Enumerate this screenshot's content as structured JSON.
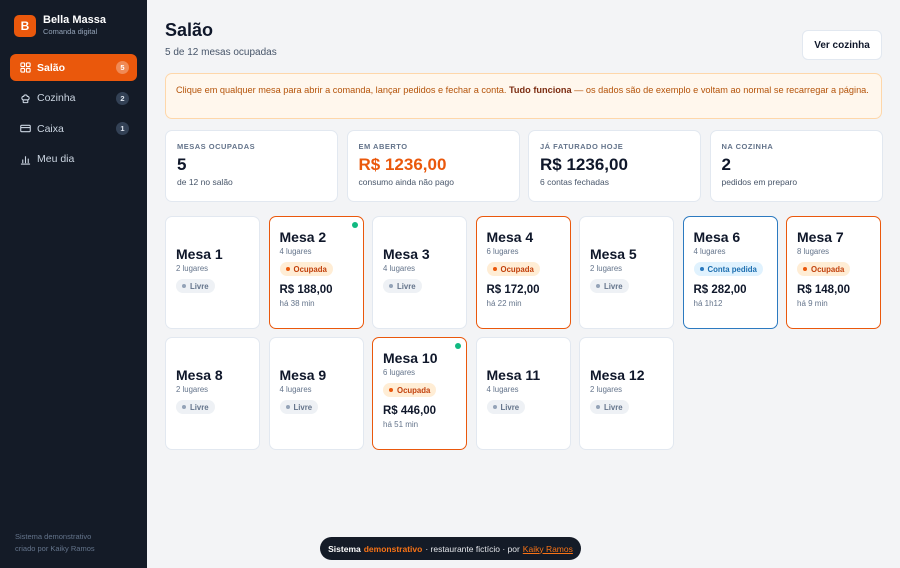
{
  "brand": {
    "logo_letter": "B",
    "name": "Bella Massa",
    "subtitle": "Comanda digital"
  },
  "sidebar": {
    "items": [
      {
        "label": "Salão",
        "badge": "5",
        "icon": "grid-icon",
        "active": true
      },
      {
        "label": "Cozinha",
        "badge": "2",
        "icon": "chef-hat-icon",
        "active": false
      },
      {
        "label": "Caixa",
        "badge": "1",
        "icon": "credit-card-icon",
        "active": false
      },
      {
        "label": "Meu dia",
        "badge": "",
        "icon": "bar-chart-icon",
        "active": false
      }
    ],
    "footer_line1": "Sistema demonstrativo",
    "footer_line2": "criado por Kaiky Ramos"
  },
  "header": {
    "title": "Salão",
    "subtitle": "5 de 12 mesas ocupadas",
    "kitchen_button": "Ver cozinha"
  },
  "notice": {
    "text_before": "Clique em qualquer mesa para abrir a comanda, lançar pedidos e fechar a conta.",
    "bold": "Tudo funciona",
    "text_after": "— os dados são de exemplo e voltam ao normal se recarregar a página."
  },
  "stats": [
    {
      "label": "Mesas ocupadas",
      "value": "5",
      "note": "de 12 no salão",
      "accent": false
    },
    {
      "label": "Em aberto",
      "value": "R$ 1236,00",
      "note": "consumo ainda não pago",
      "accent": true
    },
    {
      "label": "Já faturado hoje",
      "value": "R$ 1236,00",
      "note": "6 contas fechadas",
      "accent": false
    },
    {
      "label": "Na cozinha",
      "value": "2",
      "note": "pedidos em preparo",
      "accent": false
    }
  ],
  "tables": [
    {
      "name": "Mesa 1",
      "seats": "2 lugares",
      "status": "free",
      "status_label": "Livre"
    },
    {
      "name": "Mesa 2",
      "seats": "4 lugares",
      "status": "occupied",
      "status_label": "Ocupada",
      "amount": "R$ 188,00",
      "time": "há 38 min",
      "ready": true
    },
    {
      "name": "Mesa 3",
      "seats": "4 lugares",
      "status": "free",
      "status_label": "Livre"
    },
    {
      "name": "Mesa 4",
      "seats": "6 lugares",
      "status": "occupied",
      "status_label": "Ocupada",
      "amount": "R$ 172,00",
      "time": "há 22 min",
      "ready": false
    },
    {
      "name": "Mesa 5",
      "seats": "2 lugares",
      "status": "free",
      "status_label": "Livre"
    },
    {
      "name": "Mesa 6",
      "seats": "4 lugares",
      "status": "bill",
      "status_label": "Conta pedida",
      "amount": "R$ 282,00",
      "time": "há 1h12",
      "ready": false
    },
    {
      "name": "Mesa 7",
      "seats": "8 lugares",
      "status": "occupied",
      "status_label": "Ocupada",
      "amount": "R$ 148,00",
      "time": "há 9 min",
      "ready": false
    },
    {
      "name": "Mesa 8",
      "seats": "2 lugares",
      "status": "free",
      "status_label": "Livre"
    },
    {
      "name": "Mesa 9",
      "seats": "4 lugares",
      "status": "free",
      "status_label": "Livre"
    },
    {
      "name": "Mesa 10",
      "seats": "6 lugares",
      "status": "occupied",
      "status_label": "Ocupada",
      "amount": "R$ 446,00",
      "time": "há 51 min",
      "ready": true
    },
    {
      "name": "Mesa 11",
      "seats": "4 lugares",
      "status": "free",
      "status_label": "Livre"
    },
    {
      "name": "Mesa 12",
      "seats": "2 lugares",
      "status": "free",
      "status_label": "Livre"
    }
  ],
  "footer": {
    "lead": "Sistema",
    "highlight": "demonstrativo",
    "middle": "· restaurante fictício · por",
    "link": "Kaiky Ramos"
  },
  "colors": {
    "accent": "#ea580c",
    "sidebar_bg": "#141b27",
    "bill_blue": "#2c7ac0",
    "ready_green": "#10b981"
  }
}
